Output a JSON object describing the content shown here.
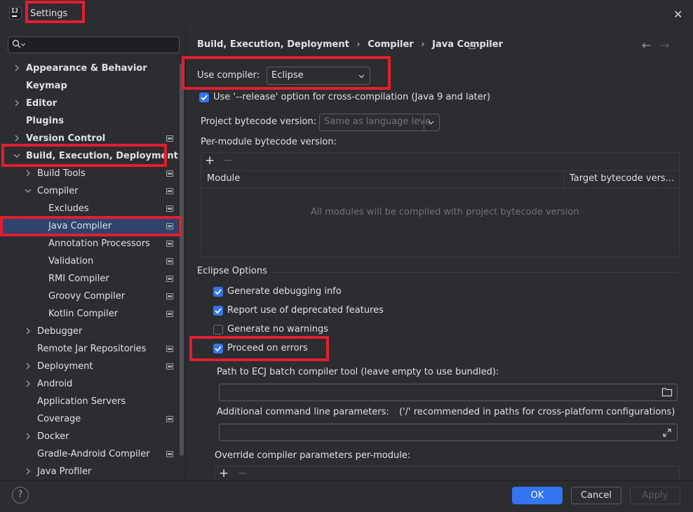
{
  "window": {
    "title": "Settings"
  },
  "search": {
    "placeholder": ""
  },
  "sidebar": {
    "items": [
      {
        "label": "Appearance & Behavior"
      },
      {
        "label": "Keymap"
      },
      {
        "label": "Editor"
      },
      {
        "label": "Plugins"
      },
      {
        "label": "Version Control"
      },
      {
        "label": "Build, Execution, Deployment"
      },
      {
        "label": "Build Tools"
      },
      {
        "label": "Compiler"
      },
      {
        "label": "Excludes"
      },
      {
        "label": "Java Compiler"
      },
      {
        "label": "Annotation Processors"
      },
      {
        "label": "Validation"
      },
      {
        "label": "RMI Compiler"
      },
      {
        "label": "Groovy Compiler"
      },
      {
        "label": "Kotlin Compiler"
      },
      {
        "label": "Debugger"
      },
      {
        "label": "Remote Jar Repositories"
      },
      {
        "label": "Deployment"
      },
      {
        "label": "Android"
      },
      {
        "label": "Application Servers"
      },
      {
        "label": "Coverage"
      },
      {
        "label": "Docker"
      },
      {
        "label": "Gradle-Android Compiler"
      },
      {
        "label": "Java Profiler"
      }
    ]
  },
  "breadcrumb": {
    "part1": "Build, Execution, Deployment",
    "sep": "›",
    "part2": "Compiler",
    "part3": "Java Compiler",
    "back": "←",
    "forward": "→"
  },
  "compiler": {
    "use_compiler_label": "Use compiler:",
    "use_compiler_value": "Eclipse",
    "release_option_label": "Use '--release' option for cross-compilation (Java 9 and later)",
    "release_option_checked": true,
    "bytecode_label": "Project bytecode version:",
    "bytecode_placeholder": "Same as language leve",
    "per_module_label": "Per-module bytecode version:",
    "table_add": "+",
    "table_remove": "−",
    "col_module": "Module",
    "col_target": "Target bytecode vers...",
    "table_empty": "All modules will be compiled with project bytecode version"
  },
  "eclipse": {
    "section_title": "Eclipse Options",
    "options": [
      {
        "label": "Generate debugging info",
        "checked": true
      },
      {
        "label": "Report use of deprecated features",
        "checked": true
      },
      {
        "label": "Generate no warnings",
        "checked": false
      },
      {
        "label": "Proceed on errors",
        "checked": true
      }
    ],
    "ecj_path_label": "Path to ECJ batch compiler tool (leave empty to use bundled):",
    "additional_params_label": "Additional command line parameters:",
    "additional_params_hint": "('/' recommended in paths for cross-platform configurations)",
    "override_label": "Override compiler parameters per-module:",
    "override_add": "+",
    "override_remove": "−"
  },
  "footer": {
    "help": "?",
    "ok": "OK",
    "cancel": "Cancel",
    "apply": "Apply"
  },
  "colors": {
    "accent": "#3574f0",
    "highlight": "#e0202f",
    "selection": "#2e436e"
  }
}
